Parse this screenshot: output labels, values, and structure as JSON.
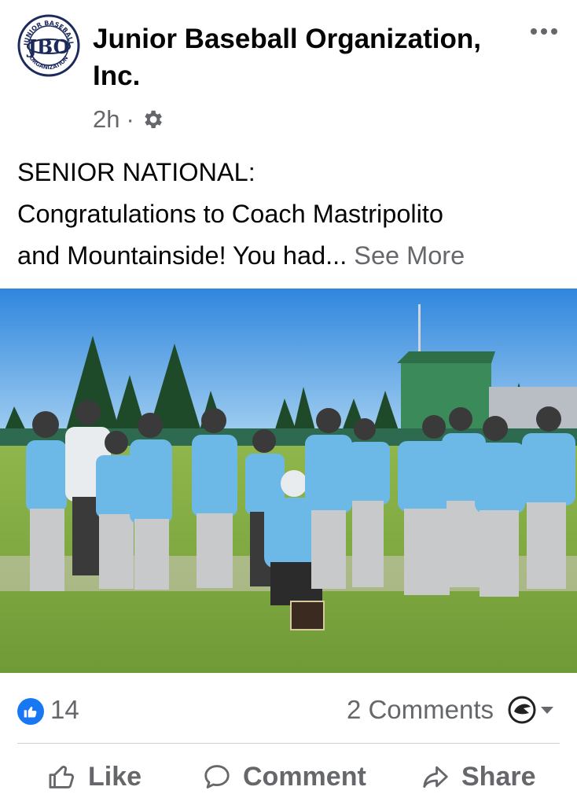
{
  "post": {
    "page_name": "Junior Baseball Organization, Inc.",
    "time": "2h",
    "separator": "·",
    "audience_icon": "gear-icon",
    "text_line1": "SENIOR NATIONAL:",
    "text_line2": "Congratulations to Coach Mastripolito",
    "text_line3": "and Mountainside! You had...",
    "see_more": "See More",
    "logo": {
      "top_text": "JUNIOR BASEBALL",
      "center_text": "JBO",
      "bottom_text": "ORGANIZATION"
    }
  },
  "stats": {
    "reactions_count": "14",
    "comments": "2 Comments"
  },
  "actions": {
    "like": "Like",
    "comment": "Comment",
    "share": "Share"
  },
  "colors": {
    "accent": "#1877f2",
    "muted": "#65676b",
    "divider": "#ced0d4",
    "jersey": "#6cb8e6"
  }
}
